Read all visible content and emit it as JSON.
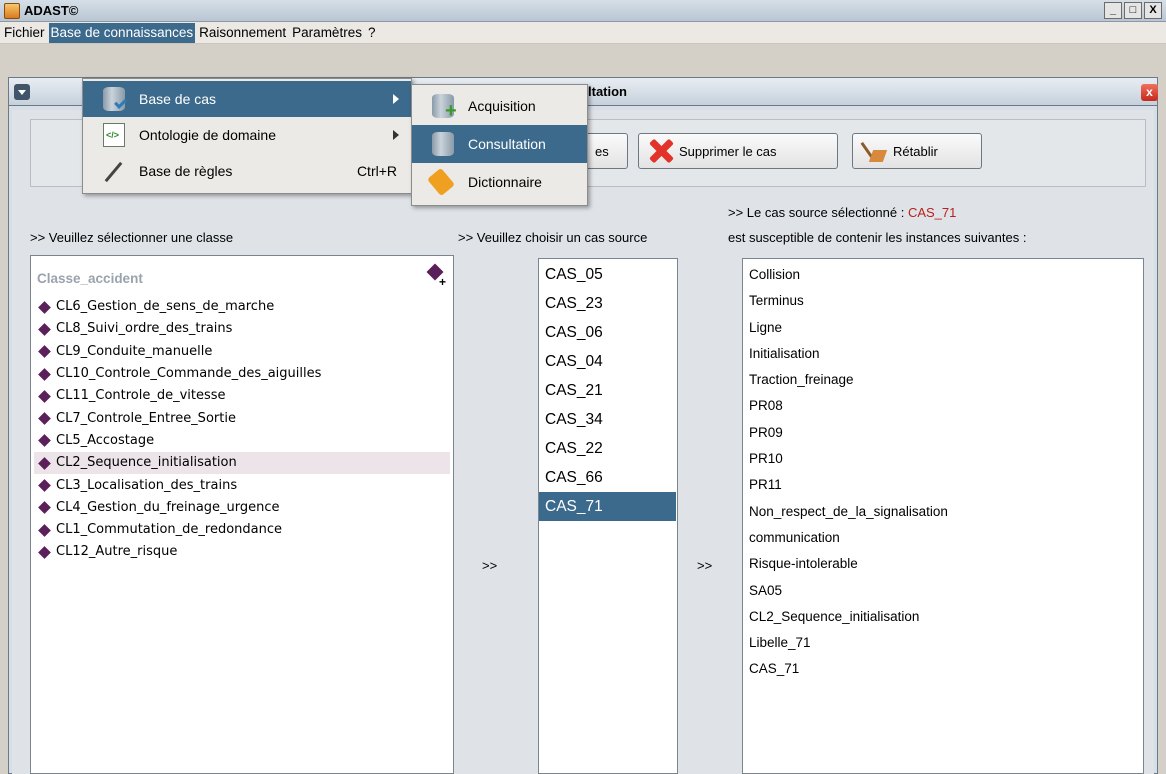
{
  "window": {
    "title": "ADAST©",
    "minimize": "_",
    "maximize": "□",
    "close": "X"
  },
  "menubar": [
    "Fichier",
    "Base de connaissances",
    "Raisonnement",
    "Paramètres",
    "?"
  ],
  "inner_window": {
    "title_fragment": "ltation",
    "close": "x"
  },
  "toolbar": {
    "partial_button": "es",
    "delete_button": "Supprimer le cas",
    "restore_button": "Rétablir"
  },
  "labels": {
    "select_class": ">> Veuillez sélectionner une classe",
    "choose_case": ">> Veuillez choisir un cas source",
    "selected_case_prefix": ">> Le cas source sélectionné : ",
    "selected_case_value": "CAS_71",
    "instances_line": "est susceptible de contenir les instances suivantes :",
    "arrow_left": ">>",
    "arrow_right": ">>"
  },
  "class_panel": {
    "header": "Classe_accident",
    "items": [
      "CL6_Gestion_de_sens_de_marche",
      "CL8_Suivi_ordre_des_trains",
      "CL9_Conduite_manuelle",
      "CL10_Controle_Commande_des_aiguilles",
      "CL11_Controle_de_vitesse",
      "CL7_Controle_Entree_Sortie",
      "CL5_Accostage",
      "CL2_Sequence_initialisation",
      "CL3_Localisation_des_trains",
      "CL4_Gestion_du_freinage_urgence",
      "CL1_Commutation_de_redondance",
      "CL12_Autre_risque"
    ],
    "selected": "CL2_Sequence_initialisation"
  },
  "cases": {
    "items": [
      "CAS_05",
      "CAS_23",
      "CAS_06",
      "CAS_04",
      "CAS_21",
      "CAS_34",
      "CAS_22",
      "CAS_66",
      "CAS_71"
    ],
    "selected": "CAS_71"
  },
  "instances": [
    "Collision",
    "Terminus",
    "Ligne",
    "Initialisation",
    "Traction_freinage",
    "PR08",
    "PR09",
    "PR10",
    "PR11",
    "Non_respect_de_la_signalisation",
    "communication",
    "Risque-intolerable",
    "SA05",
    "CL2_Sequence_initialisation",
    "Libelle_71",
    "CAS_71"
  ],
  "menu_dropdown": {
    "items": [
      {
        "label": "Base de cas",
        "icon": "database-icon",
        "shortcut": "",
        "submenu": true
      },
      {
        "label": "Ontologie de domaine",
        "icon": "xml-document-icon",
        "shortcut": "",
        "submenu": true
      },
      {
        "label": "Base de règles",
        "icon": "pencil-icon",
        "shortcut": "Ctrl+R",
        "submenu": false
      }
    ]
  },
  "submenu": {
    "items": [
      {
        "label": "Acquisition",
        "icon": "database-add-icon"
      },
      {
        "label": "Consultation",
        "icon": "database-icon"
      },
      {
        "label": "Dictionnaire",
        "icon": "tag-icon"
      }
    ]
  },
  "colors": {
    "selection": "#3c6a8c",
    "accent_red": "#b8201a",
    "diamond": "#5b1f5a"
  }
}
